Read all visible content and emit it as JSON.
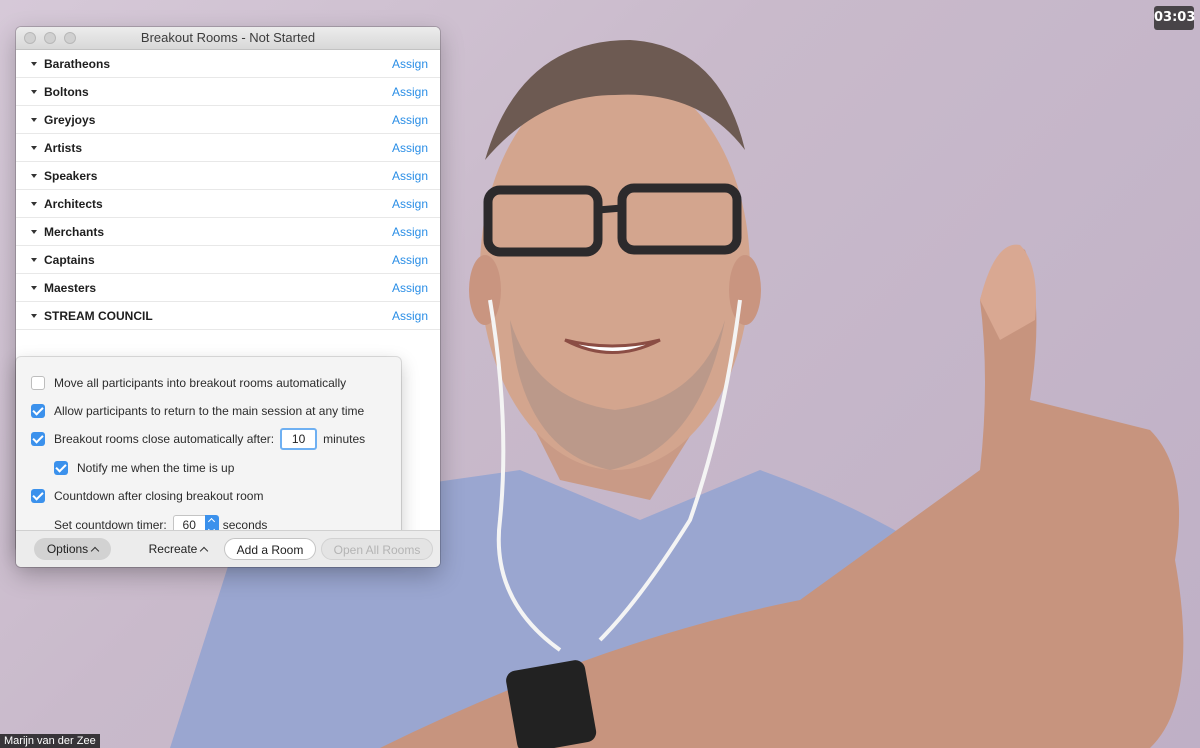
{
  "video": {
    "timer": "03:03",
    "participant_name": "Marijn van der Zee"
  },
  "window": {
    "title": "Breakout Rooms - Not Started",
    "rooms": [
      {
        "name": "Baratheons",
        "action": "Assign"
      },
      {
        "name": "Boltons",
        "action": "Assign"
      },
      {
        "name": "Greyjoys",
        "action": "Assign"
      },
      {
        "name": "Artists",
        "action": "Assign"
      },
      {
        "name": "Speakers",
        "action": "Assign"
      },
      {
        "name": "Architects",
        "action": "Assign"
      },
      {
        "name": "Merchants",
        "action": "Assign"
      },
      {
        "name": "Captains",
        "action": "Assign"
      },
      {
        "name": "Maesters",
        "action": "Assign"
      },
      {
        "name": "STREAM COUNCIL",
        "action": "Assign"
      }
    ]
  },
  "options": {
    "move_auto": {
      "label": "Move all participants into breakout rooms automatically",
      "checked": false
    },
    "allow_return": {
      "label": "Allow participants to return to the main session at any time",
      "checked": true
    },
    "auto_close": {
      "label": "Breakout rooms close automatically after:",
      "checked": true,
      "value": "10",
      "unit": "minutes"
    },
    "notify": {
      "label": "Notify me when the time is up",
      "checked": true
    },
    "countdown": {
      "label": "Countdown after closing breakout room",
      "checked": true
    },
    "countdown_timer": {
      "label": "Set countdown timer:",
      "value": "60",
      "unit": "seconds"
    }
  },
  "footer": {
    "options_label": "Options",
    "recreate_label": "Recreate",
    "add_room_label": "Add a Room",
    "open_all_label": "Open All Rooms"
  },
  "colors": {
    "accent": "#3b91ec",
    "link": "#2a8ee6"
  }
}
